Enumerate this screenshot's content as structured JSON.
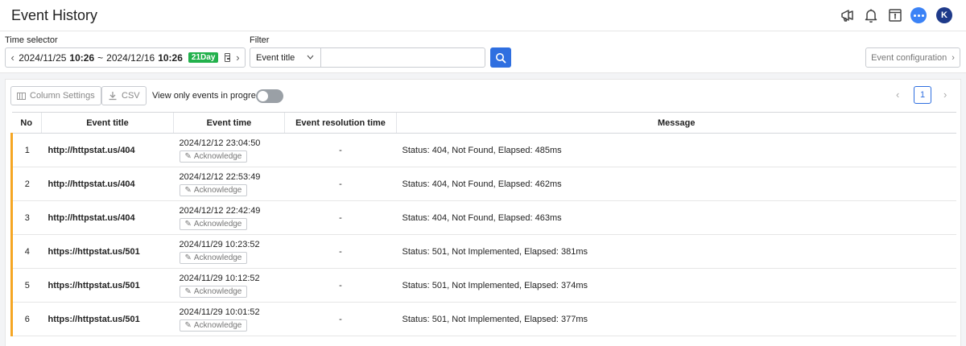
{
  "header": {
    "title": "Event History",
    "avatar_initial": "K",
    "icons": [
      "megaphone-icon",
      "bell-icon",
      "info-panel-icon",
      "chat-icon"
    ]
  },
  "controls": {
    "time_selector_label": "Time selector",
    "time_start_date": "2024/11/25",
    "time_start_time": "10:26",
    "time_sep": "~",
    "time_end_date": "2024/12/16",
    "time_end_time": "10:26",
    "range_badge": "21Day",
    "filter_label": "Filter",
    "filter_select_value": "Event title",
    "filter_input_value": "",
    "event_config_label": "Event configuration"
  },
  "toolbar": {
    "column_settings_label": "Column Settings",
    "csv_label": "CSV",
    "toggle_label": "View only events in progress",
    "toggle_on": false,
    "current_page": "1"
  },
  "table": {
    "headers": [
      "No",
      "Event title",
      "Event time",
      "Event resolution time",
      "Message"
    ],
    "acknowledge_label": "Acknowledge",
    "status_color": "#f5a623",
    "rows": [
      {
        "no": "1",
        "title": "http://httpstat.us/404",
        "time": "2024/12/12 23:04:50",
        "resolution": "-",
        "message": "Status: 404, Not Found, Elapsed: 485ms"
      },
      {
        "no": "2",
        "title": "http://httpstat.us/404",
        "time": "2024/12/12 22:53:49",
        "resolution": "-",
        "message": "Status: 404, Not Found, Elapsed: 462ms"
      },
      {
        "no": "3",
        "title": "http://httpstat.us/404",
        "time": "2024/12/12 22:42:49",
        "resolution": "-",
        "message": "Status: 404, Not Found, Elapsed: 463ms"
      },
      {
        "no": "4",
        "title": "https://httpstat.us/501",
        "time": "2024/11/29 10:23:52",
        "resolution": "-",
        "message": "Status: 501, Not Implemented, Elapsed: 381ms"
      },
      {
        "no": "5",
        "title": "https://httpstat.us/501",
        "time": "2024/11/29 10:12:52",
        "resolution": "-",
        "message": "Status: 501, Not Implemented, Elapsed: 374ms"
      },
      {
        "no": "6",
        "title": "https://httpstat.us/501",
        "time": "2024/11/29 10:01:52",
        "resolution": "-",
        "message": "Status: 501, Not Implemented, Elapsed: 377ms"
      }
    ]
  },
  "colors": {
    "accent": "#2f6fe0",
    "badge_green": "#22b14c",
    "avatar_bg": "#1e3a8a",
    "chat_bg": "#3b82f6",
    "event_marker": "#f5a623"
  }
}
